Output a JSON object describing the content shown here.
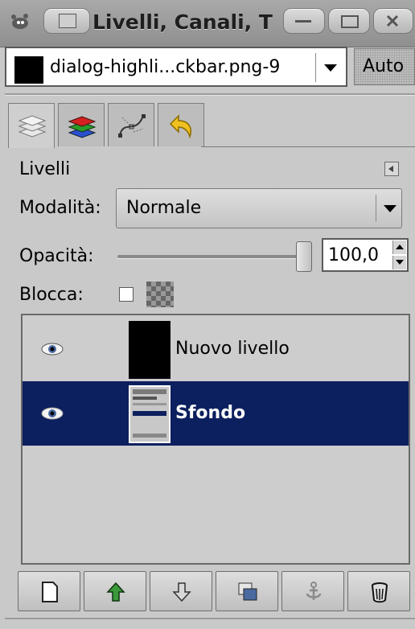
{
  "window": {
    "title": "Livelli, Canali, T",
    "buttons": [
      "minimize-button",
      "maximize-button",
      "close-button"
    ]
  },
  "image_selector": {
    "value": "dialog-highli...ckbar.png-9",
    "auto_label": "Auto"
  },
  "tabs": [
    {
      "name": "layers",
      "icon": "layers-icon"
    },
    {
      "name": "channels",
      "icon": "channels-icon"
    },
    {
      "name": "paths",
      "icon": "paths-icon"
    },
    {
      "name": "undo",
      "icon": "undo-icon"
    }
  ],
  "layers_panel": {
    "title": "Livelli",
    "mode_label": "Modalità:",
    "mode_value": "Normale",
    "opacity_label": "Opacità:",
    "opacity_value": "100,0",
    "opacity_fraction": 1.0,
    "lock_label": "Blocca:",
    "layers": [
      {
        "name": "Nuovo livello",
        "visible": true,
        "selected": false
      },
      {
        "name": "Sfondo",
        "visible": true,
        "selected": true
      }
    ]
  },
  "colors": {
    "selection": "#0c1f5e",
    "background": "#c9c9c9"
  }
}
